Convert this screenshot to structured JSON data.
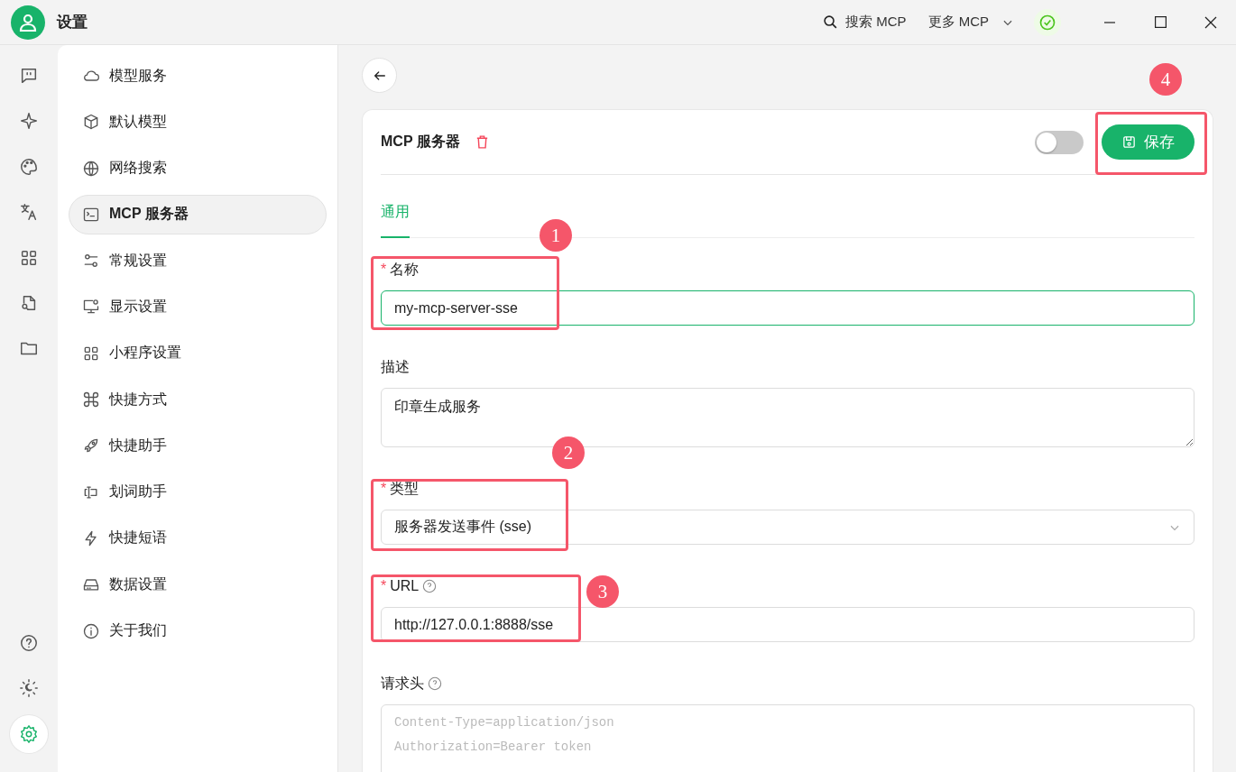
{
  "window": {
    "title": "设置"
  },
  "titlebar": {
    "search": "搜索 MCP",
    "more": "更多 MCP"
  },
  "rail": [
    {
      "kind": "chat",
      "selected": false
    },
    {
      "kind": "sparkle",
      "selected": false
    },
    {
      "kind": "palette",
      "selected": false
    },
    {
      "kind": "translate",
      "selected": false
    },
    {
      "kind": "apps",
      "selected": false
    },
    {
      "kind": "doc-search",
      "selected": false
    },
    {
      "kind": "folder",
      "selected": false
    },
    {
      "kind": "help",
      "selected": false
    },
    {
      "kind": "theme",
      "selected": false
    },
    {
      "kind": "settings",
      "selected": true
    }
  ],
  "sidebar": {
    "items": [
      {
        "label": "模型服务",
        "kind": "cloud",
        "selected": false
      },
      {
        "label": "默认模型",
        "kind": "cube",
        "selected": false
      },
      {
        "label": "网络搜索",
        "kind": "globe",
        "selected": false
      },
      {
        "label": "MCP 服务器",
        "kind": "terminal",
        "selected": true
      },
      {
        "label": "常规设置",
        "kind": "sliders",
        "selected": false
      },
      {
        "label": "显示设置",
        "kind": "monitor",
        "selected": false
      },
      {
        "label": "小程序设置",
        "kind": "apps",
        "selected": false
      },
      {
        "label": "快捷方式",
        "kind": "command",
        "selected": false
      },
      {
        "label": "快捷助手",
        "kind": "rocket",
        "selected": false
      },
      {
        "label": "划词助手",
        "kind": "cursor",
        "selected": false
      },
      {
        "label": "快捷短语",
        "kind": "bolt",
        "selected": false
      },
      {
        "label": "数据设置",
        "kind": "drive",
        "selected": false
      },
      {
        "label": "关于我们",
        "kind": "info",
        "selected": false
      }
    ]
  },
  "server": {
    "title": "MCP 服务器",
    "enabled": false,
    "save": "保存",
    "callout": "4"
  },
  "tabs": [
    {
      "label": "通用",
      "selected": true
    }
  ],
  "fields": [
    {
      "kind": "input",
      "label": "名称",
      "mark": "*",
      "help": false,
      "value": "my-mcp-server-sse",
      "focused": true,
      "callout": "1"
    },
    {
      "kind": "textarea",
      "label": "描述",
      "help": false,
      "value": "印章生成服务",
      "focused": false
    },
    {
      "kind": "select",
      "label": "类型",
      "mark": "*",
      "help": false,
      "value": "服务器发送事件 (sse)",
      "focused": false,
      "callout": "2"
    },
    {
      "kind": "input",
      "label": "URL",
      "mark": "*",
      "help": true,
      "value": "http://127.0.0.1:8888/sse",
      "focused": false,
      "callout": "3"
    },
    {
      "kind": "textarea",
      "label": "请求头",
      "help": true,
      "placeholder": "Content-Type=application/json\nAuthorization=Bearer token",
      "focused": false
    }
  ]
}
